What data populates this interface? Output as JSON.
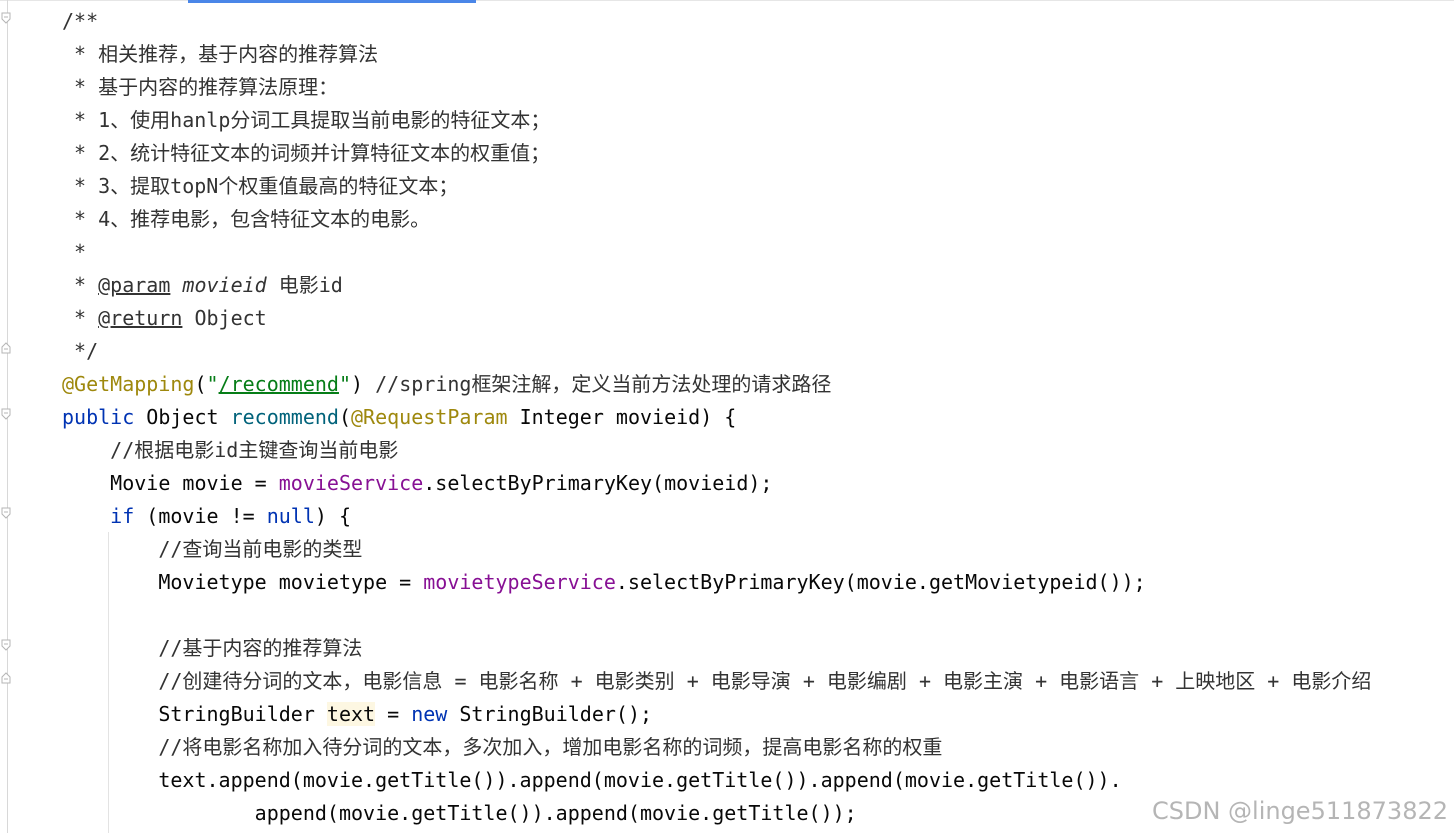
{
  "editor": {
    "lines": {
      "l1": "/**",
      "l2": " * 相关推荐，基于内容的推荐算法",
      "l3": " * 基于内容的推荐算法原理：",
      "l4": " * 1、使用hanlp分词工具提取当前电影的特征文本；",
      "l5": " * 2、统计特征文本的词频并计算特征文本的权重值；",
      "l6": " * 3、提取topN个权重值最高的特征文本；",
      "l7": " * 4、推荐电影，包含特征文本的电影。",
      "l8": " *",
      "l9_prefix": " * ",
      "l9_tag": "@param",
      "l9_name": "movieid",
      "l9_desc": " 电影id",
      "l10_prefix": " * ",
      "l10_tag": "@return",
      "l10_desc": " Object",
      "l11": " */",
      "l12_annot": "@GetMapping",
      "l12_open": "(",
      "l12_q1": "\"",
      "l12_path": "/recommend",
      "l12_q2": "\"",
      "l12_close": ") ",
      "l12_comment": "//spring框架注解，定义当前方法处理的请求路径",
      "l13_kw": "public",
      "l13_type": " Object ",
      "l13_method": "recommend",
      "l13_open": "(",
      "l13_annot": "@RequestParam",
      "l13_rest": " Integer movieid) {",
      "l14": "    //根据电影id主键查询当前电影",
      "l15_a": "    Movie movie = ",
      "l15_field": "movieService",
      "l15_b": ".selectByPrimaryKey(movieid);",
      "l16_indent": "    ",
      "l16_kw": "if",
      "l16_a": " (movie != ",
      "l16_null": "null",
      "l16_b": ") {",
      "l17": "        //查询当前电影的类型",
      "l18_a": "        Movietype movietype = ",
      "l18_field": "movietypeService",
      "l18_b": ".selectByPrimaryKey(movie.getMovietypeid());",
      "l19": "",
      "l20": "        //基于内容的推荐算法",
      "l21": "        //创建待分词的文本，电影信息 = 电影名称 + 电影类别 + 电影导演 + 电影编剧 + 电影主演 + 电影语言 + 上映地区 + 电影介绍",
      "l22_a": "        StringBuilder ",
      "l22_var": "text",
      "l22_b": " = ",
      "l22_kw": "new",
      "l22_c": " StringBuilder();",
      "l23": "        //将电影名称加入待分词的文本，多次加入，增加电影名称的词频，提高电影名称的权重",
      "l24": "        text.append(movie.getTitle()).append(movie.getTitle()).append(movie.getTitle()).",
      "l25": "                append(movie.getTitle()).append(movie.getTitle());"
    }
  },
  "watermark": "CSDN @linge511873822",
  "colors": {
    "keyword": "#0033b3",
    "annotation": "#9e880d",
    "string": "#067d17",
    "field": "#871094",
    "method": "#00627a",
    "comment": "#333333",
    "tab_indicator": "#4a86e8"
  }
}
